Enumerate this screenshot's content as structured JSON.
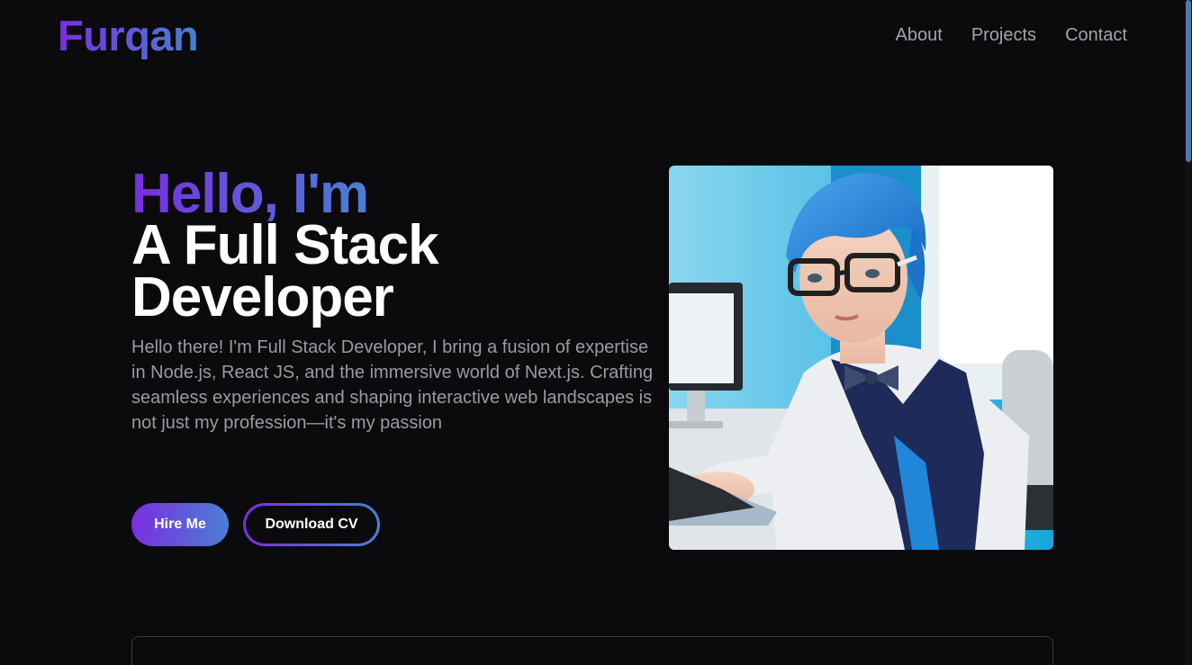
{
  "header": {
    "logo": "Furqan",
    "nav": [
      "About",
      "Projects",
      "Contact"
    ]
  },
  "hero": {
    "greeting": "Hello, I'm",
    "headline_line1": "A Full Stack",
    "headline_line2": "Developer",
    "intro": "Hello there! I'm Full Stack Developer, I bring a fusion of expertise in Node.js, React JS, and the immersive world of Next.js. Crafting seamless experiences and shaping interactive web landscapes is not just my profession—it's my passion",
    "hire_button": "Hire Me",
    "cv_button": "Download CV"
  },
  "colors": {
    "background": "#0b0b0e",
    "gradient_start": "#7a2ee0",
    "gradient_end": "#4a7fd4",
    "muted_text": "#9a9aa0"
  }
}
